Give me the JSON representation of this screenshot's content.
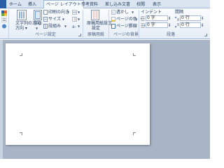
{
  "tabs": {
    "home": "ホーム",
    "insert": "挿入",
    "page_layout": "ページ レイアウト",
    "references": "参考資料",
    "mailings": "差し込み文書",
    "review": "校閲",
    "view": "表示"
  },
  "page_setup": {
    "text_direction": "文字列の方向",
    "margins": "余白",
    "orientation": "印刷の向き",
    "size": "サイズ",
    "columns": "段組み",
    "group_label": "ページ設定"
  },
  "manuscript": {
    "button": "原稿用紙設定",
    "group_label": "原稿用紙"
  },
  "background": {
    "watermark": "透かし",
    "page_color": "ページの色",
    "page_borders": "ページ罫線",
    "group_label": "ページの背景"
  },
  "paragraph": {
    "indent_label": "インデント",
    "spacing_label": "間隔",
    "indent_left": "0 字",
    "indent_right": "0 字",
    "spacing_before": "0 行",
    "spacing_after": "0 行",
    "group_label": "段落"
  },
  "colors": {
    "accent": "#2a5fa8",
    "ribbon": "#e6edf6",
    "workspace": "#a8b5c6"
  }
}
